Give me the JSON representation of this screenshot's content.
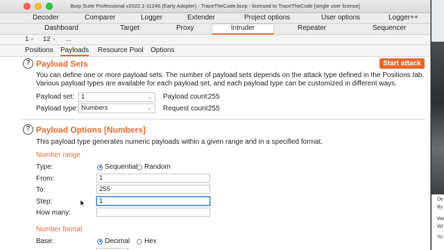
{
  "window": {
    "title": "Burp Suite Professional v2022.1-11246 (Early Adopter) - TraceTheCode.burp - licensed to TraceTheCode [single user license]"
  },
  "top_tabs_row1": [
    "Decoder",
    "Comparer",
    "Logger",
    "Extender",
    "Project options",
    "User options",
    "Logger++"
  ],
  "top_tabs_row2": [
    "Dashboard",
    "Target",
    "Proxy",
    "Intruder",
    "Repeater",
    "Sequencer"
  ],
  "active_top_tab": "Intruder",
  "attack_tabs": [
    "1",
    "12",
    "..."
  ],
  "sub_tabs": [
    "Positions",
    "Payloads",
    "Resource Pool",
    "Options"
  ],
  "active_sub_tab": "Payloads",
  "payload_sets": {
    "title": "Payload Sets",
    "start_attack": "Start attack",
    "desc_line1": "You can define one or more payload sets. The number of payload sets depends on the attack type defined in the Positions tab.",
    "desc_line2": "Various payload types are available for each payload set, and each payload type can be customized in different ways.",
    "set_label": "Payload set:",
    "set_value": "1",
    "count_label": "Payload count:",
    "count_value": "255",
    "type_label": "Payload type:",
    "type_value": "Numbers",
    "req_label": "Request count:",
    "req_value": "255"
  },
  "payload_options": {
    "title": "Payload Options [Numbers]",
    "desc": "This payload type generates numeric payloads within a given range and in a specified format.",
    "range_heading": "Number range",
    "type_label": "Type:",
    "type_options": [
      "Sequential",
      "Random"
    ],
    "type_selected": "Sequential",
    "from_label": "From:",
    "from_value": "1",
    "to_label": "To:",
    "to_value": "255",
    "step_label": "Step:",
    "step_value": "1",
    "howmany_label": "How many:",
    "howmany_value": "",
    "format_heading": "Number format",
    "base_label": "Base:",
    "base_options": [
      "Decimal",
      "Hex"
    ],
    "base_selected": "Decimal"
  },
  "right_strip": [
    "De",
    "By",
    "We",
    "WI",
    "Yo"
  ],
  "colors": {
    "accent": "#e8682b",
    "focus": "#3a73c9"
  }
}
